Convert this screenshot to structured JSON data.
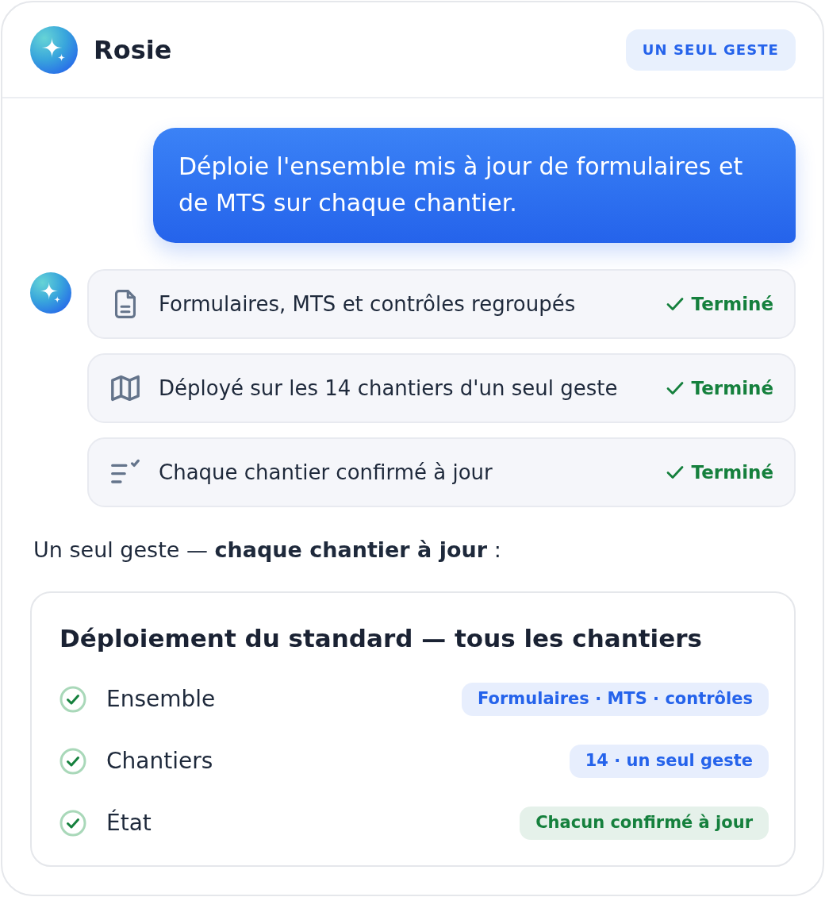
{
  "header": {
    "title": "Rosie",
    "badge": "UN SEUL GESTE"
  },
  "user_message": {
    "text": "Déploie l'ensemble mis à jour de formulaires et de MTS sur chaque chantier."
  },
  "steps": [
    {
      "kind": "document",
      "text": "Formulaires, MTS et contrôles regroupés",
      "status": "Terminé",
      "done": true
    },
    {
      "kind": "map",
      "text": "Déployé sur les 14 chantiers d'un seul geste",
      "status": "Terminé",
      "done": true
    },
    {
      "kind": "checklist",
      "text": "Chaque chantier confirmé à jour",
      "status": "Terminé",
      "done": true
    }
  ],
  "summary": "Un seul geste — **chaque chantier à jour** :",
  "result_card": {
    "title": "Déploiement du standard — tous les chantiers",
    "rows": [
      {
        "label": "Ensemble",
        "value": "Formulaires · MTS · contrôles",
        "checked": true,
        "color": "#2563eb"
      },
      {
        "label": "Chantiers",
        "value": "14 · un seul geste",
        "checked": true,
        "color": "#2563eb"
      },
      {
        "label": "État",
        "value": "Chacun confirmé à jour",
        "checked": true,
        "color": "#15803d"
      }
    ]
  }
}
